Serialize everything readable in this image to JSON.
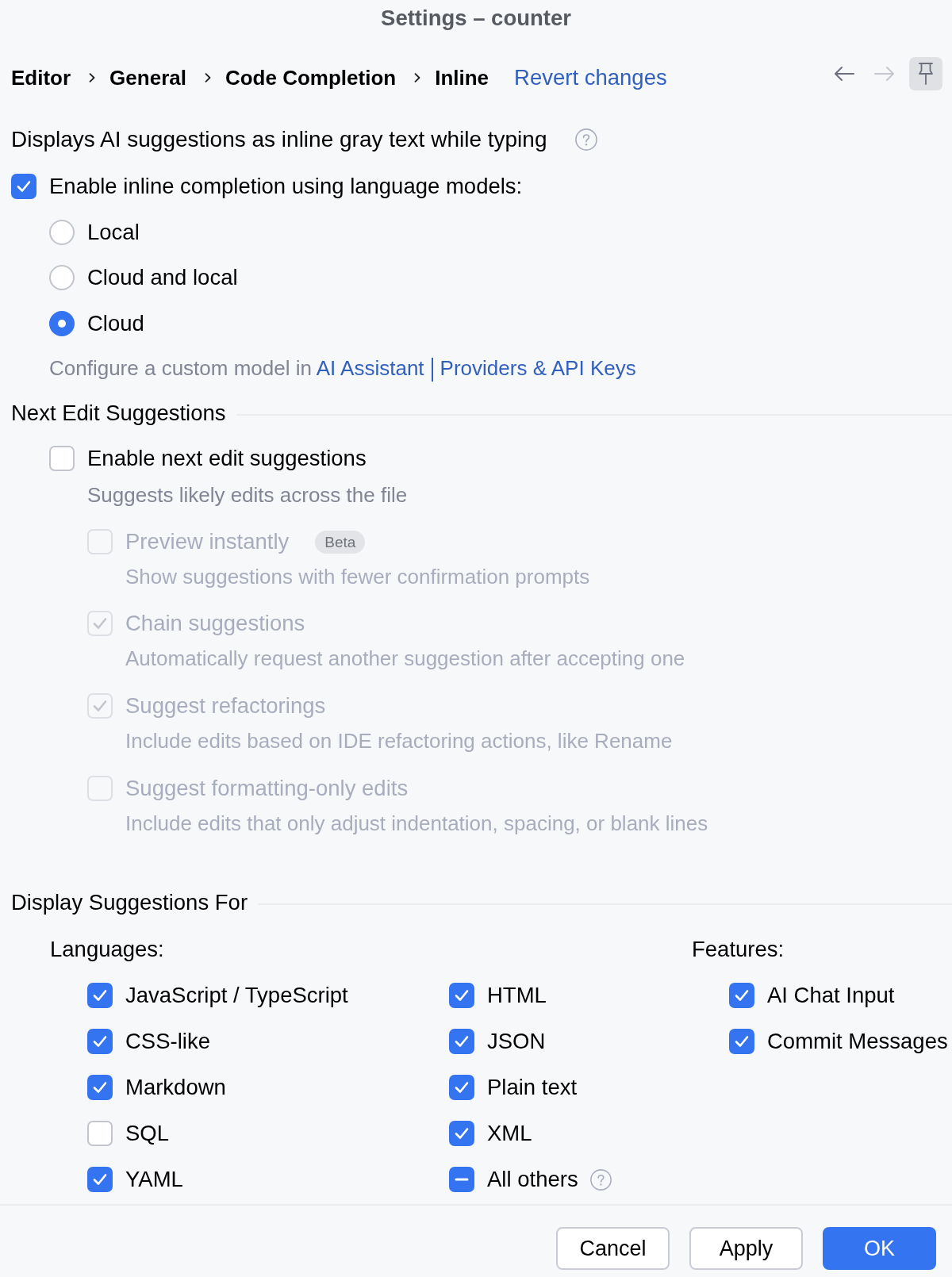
{
  "window": {
    "title": "Settings – counter"
  },
  "breadcrumb": {
    "items": [
      "Editor",
      "General",
      "Code Completion",
      "Inline"
    ],
    "revert_link": "Revert changes",
    "back": {
      "disabled": false
    },
    "forward": {
      "disabled": true
    },
    "pin": {
      "selected": true
    }
  },
  "description": "Displays AI suggestions as inline gray text while typing",
  "inline_completion": {
    "label": "Enable inline completion using language models:",
    "checked": true,
    "models": [
      {
        "label": "Local",
        "selected": false
      },
      {
        "label": "Cloud and local",
        "selected": false
      },
      {
        "label": "Cloud",
        "selected": true
      }
    ],
    "hint": {
      "text": "Configure a custom model in",
      "links": [
        "AI Assistant",
        "Providers & API Keys"
      ]
    }
  },
  "next_edit": {
    "title": "Next Edit Suggestions",
    "enable": {
      "label": "Enable next edit suggestions",
      "checked": false,
      "hint": "Suggests likely edits across the file"
    },
    "options": [
      {
        "label": "Preview instantly",
        "badge": "Beta",
        "checked": false,
        "disabled": true,
        "hint": "Show suggestions with fewer confirmation prompts"
      },
      {
        "label": "Chain suggestions",
        "checked": true,
        "disabled": true,
        "hint": "Automatically request another suggestion after accepting one"
      },
      {
        "label": "Suggest refactorings",
        "checked": true,
        "disabled": true,
        "hint": "Include edits based on IDE refactoring actions, like Rename"
      },
      {
        "label": "Suggest formatting-only edits",
        "checked": false,
        "disabled": true,
        "hint": "Include edits that only adjust indentation, spacing, or blank lines"
      }
    ]
  },
  "display": {
    "title": "Display Suggestions For",
    "languages": {
      "label": "Languages:",
      "columns": [
        [
          {
            "label": "JavaScript / TypeScript",
            "checked": true,
            "mixed": false,
            "help_icon": false
          },
          {
            "label": "CSS-like",
            "checked": true,
            "mixed": false,
            "help_icon": false
          },
          {
            "label": "Markdown",
            "checked": true,
            "mixed": false,
            "help_icon": false
          },
          {
            "label": "SQL",
            "checked": false,
            "mixed": false,
            "help_icon": false
          },
          {
            "label": "YAML",
            "checked": true,
            "mixed": false,
            "help_icon": false
          }
        ],
        [
          {
            "label": "HTML",
            "checked": true,
            "mixed": false,
            "help_icon": false
          },
          {
            "label": "JSON",
            "checked": true,
            "mixed": false,
            "help_icon": false
          },
          {
            "label": "Plain text",
            "checked": true,
            "mixed": false,
            "help_icon": false
          },
          {
            "label": "XML",
            "checked": true,
            "mixed": false,
            "help_icon": false
          },
          {
            "label": "All others",
            "mixed": true,
            "help_icon": true
          }
        ]
      ]
    },
    "features": {
      "label": "Features:",
      "columns": [
        [
          {
            "label": "AI Chat Input",
            "checked": true,
            "mixed": false,
            "help_icon": false
          },
          {
            "label": "Commit Messages",
            "checked": true,
            "mixed": false,
            "help_icon": false
          }
        ]
      ]
    }
  },
  "footer": {
    "buttons": [
      {
        "label": "Cancel",
        "kind": "secondary"
      },
      {
        "label": "Apply",
        "kind": "secondary"
      },
      {
        "label": "OK",
        "kind": "primary"
      }
    ]
  }
}
